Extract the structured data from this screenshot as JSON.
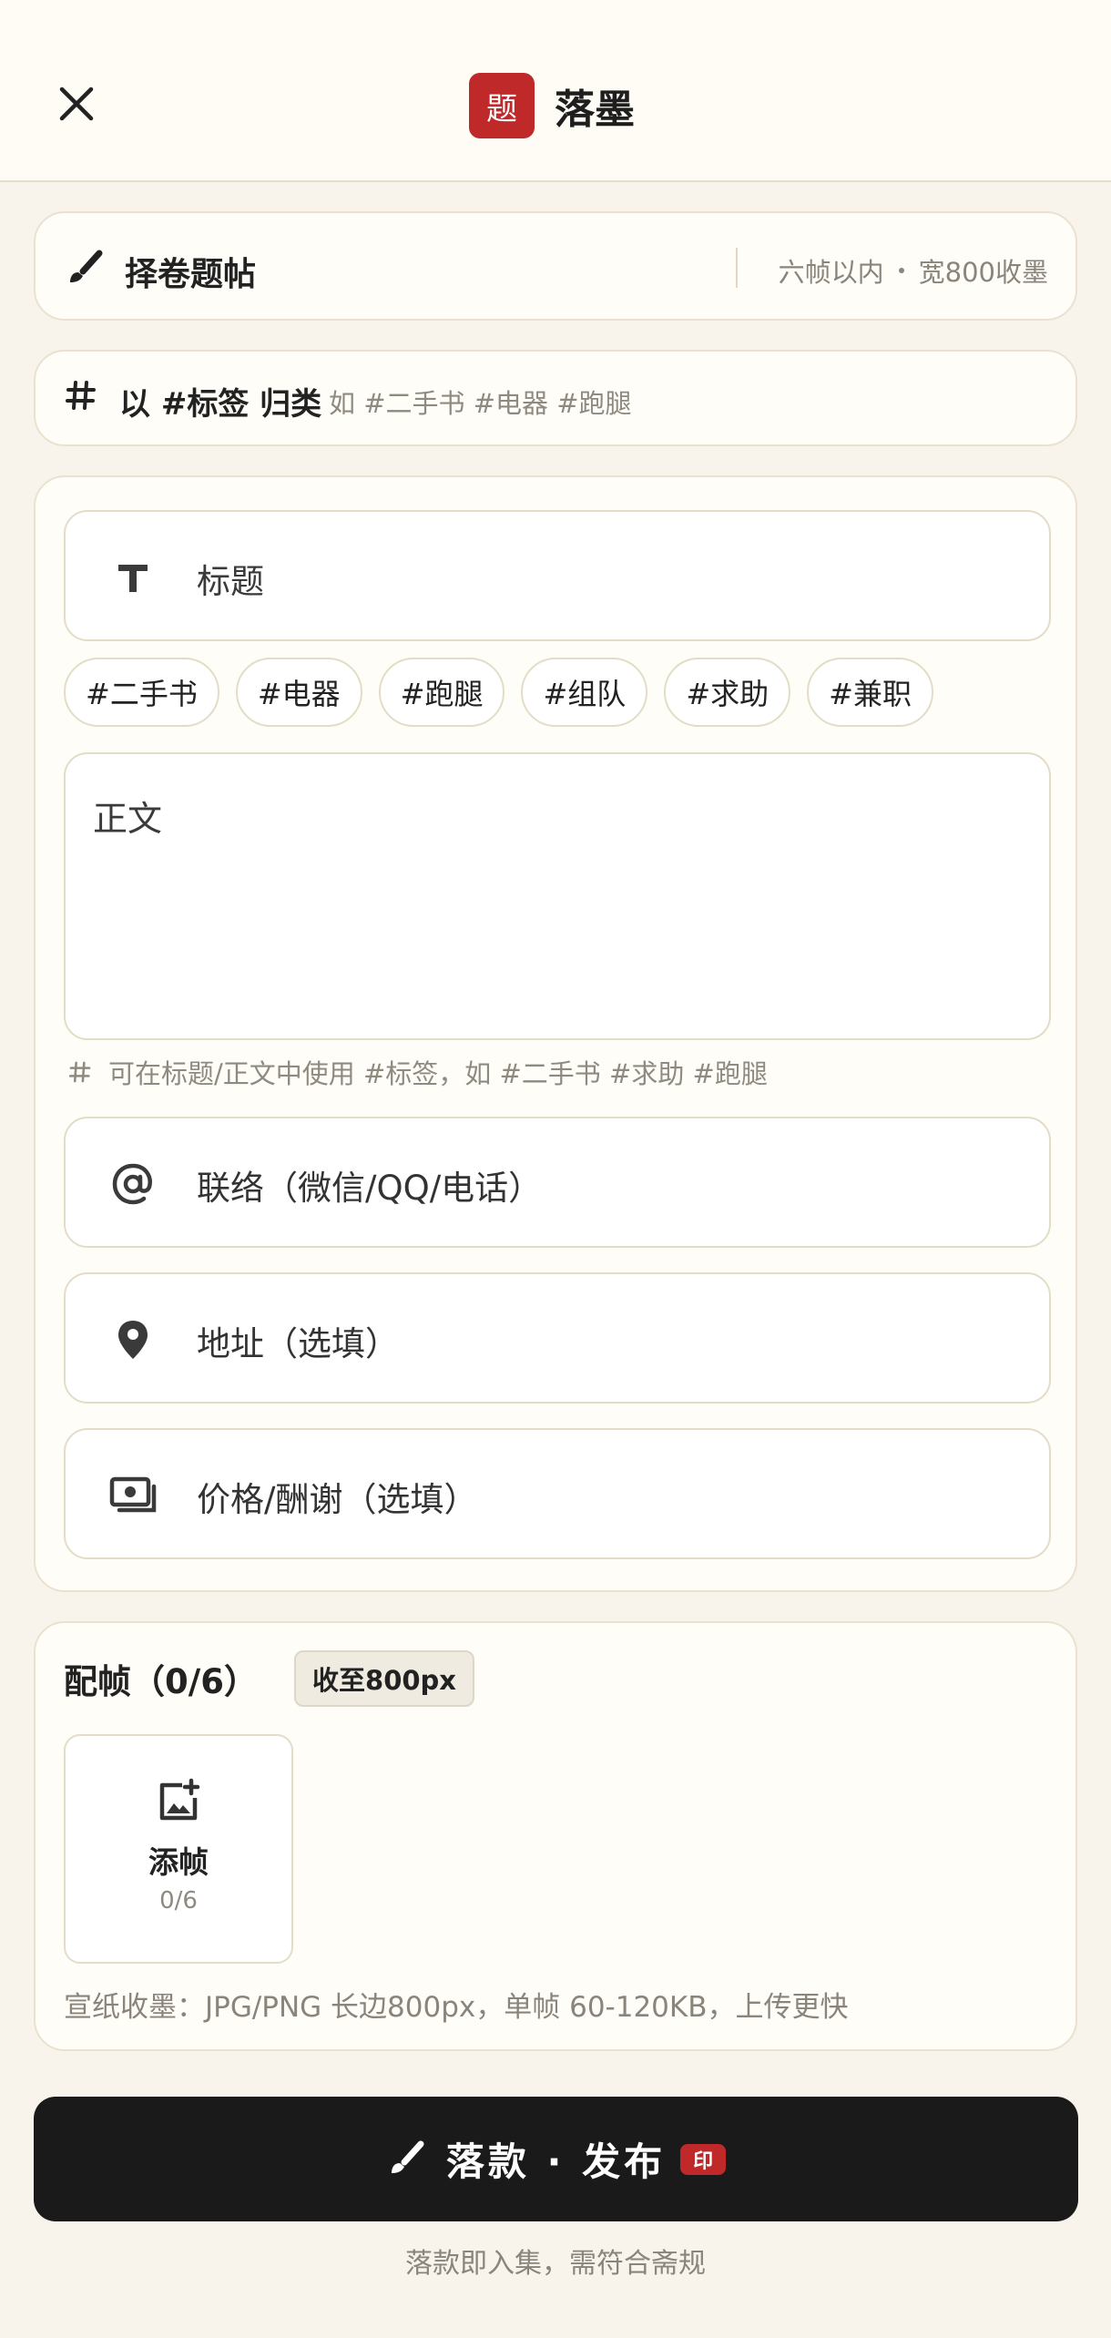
{
  "header": {
    "close_icon": "close-icon",
    "seal_char": "题",
    "app_name": "落墨"
  },
  "scroll_picker": {
    "icon": "brush-icon",
    "title": "择卷题帖",
    "meta_1": "六帧以内",
    "meta_2": "宽800收墨"
  },
  "tag_bar": {
    "icon": "hash-icon",
    "title": "以 #标签 归类",
    "hint": "如 #二手书 #电器 #跑腿"
  },
  "form": {
    "title_placeholder": "标题",
    "tags": [
      "#二手书",
      "#电器",
      "#跑腿",
      "#组队",
      "#求助",
      "#兼职"
    ],
    "body_placeholder": "正文",
    "tag_hint": "可在标题/正文中使用 #标签，如 #二手书 #求助 #跑腿",
    "contact_placeholder": "联络（微信/QQ/电话）",
    "address_placeholder": "地址（选填）",
    "price_placeholder": "价格/酬谢（选填）"
  },
  "frames": {
    "title": "配帧（0/6）",
    "badge": "收至800px",
    "add_label": "添帧",
    "add_count": "0/6",
    "note": "宣纸收墨：JPG/PNG 长边800px，单帧 60-120KB，上传更快"
  },
  "publish": {
    "label": "落款 · 发布",
    "seal": "印",
    "footnote": "落款即入集，需符合斋规"
  },
  "colors": {
    "background": "#F8F4EC",
    "seal_red": "#C0292A",
    "button_dark": "#1A1A1A"
  }
}
